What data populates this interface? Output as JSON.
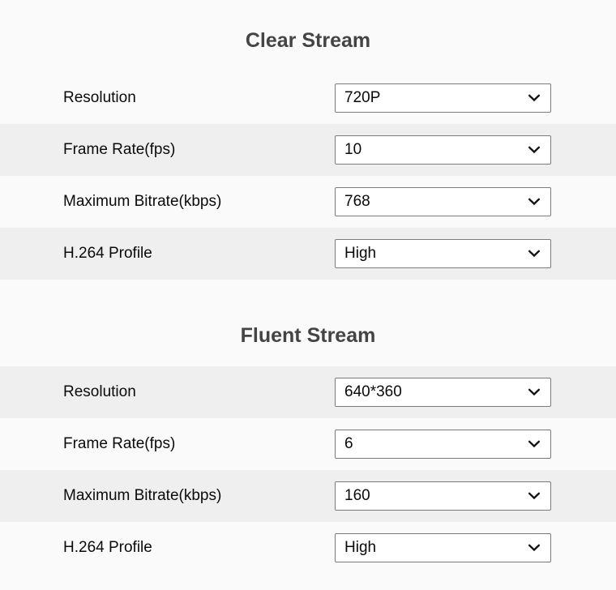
{
  "sections": [
    {
      "title": "Clear Stream",
      "rows": [
        {
          "label": "Resolution",
          "value": "720P",
          "shade": "light"
        },
        {
          "label": "Frame Rate(fps)",
          "value": "10",
          "shade": "gray"
        },
        {
          "label": "Maximum Bitrate(kbps)",
          "value": "768",
          "shade": "light"
        },
        {
          "label": "H.264 Profile",
          "value": "High",
          "shade": "gray"
        }
      ]
    },
    {
      "title": "Fluent Stream",
      "rows": [
        {
          "label": "Resolution",
          "value": "640*360",
          "shade": "gray"
        },
        {
          "label": "Frame Rate(fps)",
          "value": "6",
          "shade": "light"
        },
        {
          "label": "Maximum Bitrate(kbps)",
          "value": "160",
          "shade": "gray"
        },
        {
          "label": "H.264 Profile",
          "value": "High",
          "shade": "light"
        }
      ]
    }
  ],
  "icons": {
    "dropdown": "chevron-down-icon"
  },
  "colors": {
    "page_background": "#fafafa",
    "row_alt_background": "#efefef",
    "title_text": "#444444",
    "label_text": "#0a0a0a",
    "select_border": "#7b7b7b",
    "select_background": "#ffffff"
  }
}
